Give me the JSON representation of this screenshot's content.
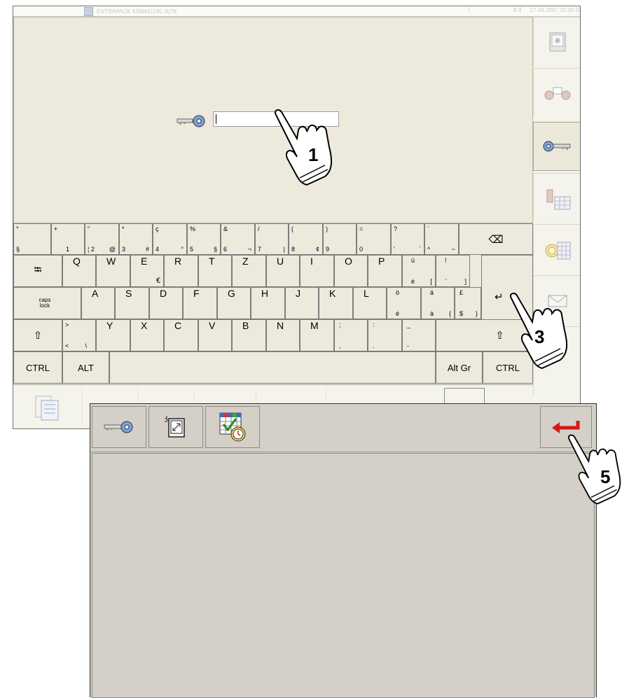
{
  "window_main": {
    "title": "ENTRAPACK 4256KDZ45 JU78",
    "number": "8.3",
    "datetime": "17.04.2007 15:36:32",
    "password_value": ""
  },
  "sidebar": {
    "items": [
      {
        "icon": "monitor-icon"
      },
      {
        "icon": "users-icon"
      },
      {
        "icon": "key-icon",
        "active": true
      },
      {
        "icon": "fire-extinguisher-calendar-icon"
      },
      {
        "icon": "target-calendar-icon"
      },
      {
        "icon": "envelope-icon"
      }
    ]
  },
  "keyboard": {
    "row1": [
      {
        "tl": "°",
        "bl": "§"
      },
      {
        "tl": "+",
        "bl": "1"
      },
      {
        "tl": "\"",
        "bl": "¦ 2",
        "br": "@"
      },
      {
        "tl": "*",
        "bl": "3",
        "br": "#"
      },
      {
        "tl": "ç",
        "bl": "4",
        "br": "°"
      },
      {
        "tl": "%",
        "bl": "5",
        "br": "§"
      },
      {
        "tl": "&",
        "bl": "6",
        "br": "¬"
      },
      {
        "tl": "/",
        "bl": "7",
        "br": "|"
      },
      {
        "tl": "(",
        "bl": "8",
        "br": "¢"
      },
      {
        "tl": ")",
        "bl": "9"
      },
      {
        "tl": "=",
        "bl": "0"
      },
      {
        "tl": "?",
        "bl": "'",
        "br": "´"
      },
      {
        "tl": "`",
        "bl": "^",
        "br": "~"
      }
    ],
    "backspace": "⌫",
    "row2_letters": [
      "Q",
      "W",
      "E",
      "R",
      "T",
      "Z",
      "U",
      "I",
      "O",
      "P"
    ],
    "row2_e_alt": "€",
    "row2_extra": [
      {
        "tl": "ü",
        "bl": "è",
        "br": "["
      },
      {
        "tl": "!",
        "bl": "¨",
        "br": "]"
      }
    ],
    "row3_letters": [
      "A",
      "S",
      "D",
      "F",
      "G",
      "H",
      "J",
      "K",
      "L"
    ],
    "row3_extra": [
      {
        "tl": "ö",
        "bl": "é"
      },
      {
        "tl": "ä",
        "bl": "à",
        "br": "{"
      },
      {
        "tl": "£",
        "bl": "$",
        "br": "}"
      }
    ],
    "caps": "caps lock",
    "row4_small": {
      "tl": ">",
      "bl": "<",
      "br": "\\"
    },
    "row4_letters": [
      "Y",
      "X",
      "C",
      "V",
      "B",
      "N",
      "M"
    ],
    "row4_extra": [
      {
        "tl": ";",
        "bl": ","
      },
      {
        "tl": ":",
        "bl": "."
      },
      {
        "tl": "_",
        "bl": "-"
      }
    ],
    "shift": "⇧",
    "tab": "⭾",
    "enter": "↵",
    "ctrl": "CTRL",
    "alt": "ALT",
    "altgr": "Alt Gr"
  },
  "callouts": {
    "one": "1",
    "three": "3",
    "five": "5"
  },
  "window_second": {
    "toolbar": [
      {
        "icon": "key-icon"
      },
      {
        "icon": "resize-window-icon"
      },
      {
        "icon": "calendar-check-clock-icon"
      }
    ],
    "exit_icon": "red-return-arrow-icon"
  },
  "colors": {
    "panel": "#ede9dc",
    "dialog": "#d4d0c8",
    "return_arrow": "#d61818",
    "key_icon_blue": "#6f9ad2"
  }
}
